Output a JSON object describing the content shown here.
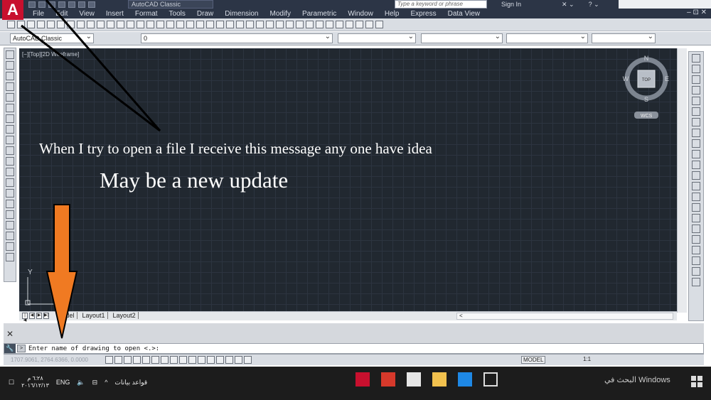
{
  "title_bar": {
    "workspace": "AutoCAD Classic",
    "search_placeholder": "Type a keyword or phrase",
    "sign_in": "Sign In"
  },
  "menu": {
    "items": [
      "File",
      "Edit",
      "View",
      "Insert",
      "Format",
      "Tools",
      "Draw",
      "Dimension",
      "Modify",
      "Parametric",
      "Window",
      "Help",
      "Express",
      "Data View"
    ],
    "window_controls": "– ⊡ ✕"
  },
  "toolbar": {
    "workspace_combo": "AutoCAD Classic",
    "layer_combo": "0"
  },
  "viewport": {
    "label": "[−][Top][2D Wireframe]",
    "viewcube_top": "TOP",
    "compass": {
      "n": "N",
      "s": "S",
      "e": "E",
      "w": "W"
    },
    "wcs": "WCS",
    "ucs_y": "Y"
  },
  "layout_tabs": [
    "Model",
    "Layout1",
    "Layout2"
  ],
  "command": {
    "prompt": "Enter name of drawing to open <.>:"
  },
  "status": {
    "coords": "1707.9061, 2764.6366, 0.0000",
    "model": "MODEL",
    "scale": "1:1"
  },
  "taskbar": {
    "clock_time": "٦:٢٨ م",
    "clock_date": "٢٠١٦/١٢/١٣",
    "lang": "ENG",
    "notif_text": "قواعد بيانات",
    "search": "البحث في Windows"
  },
  "annotations": {
    "message": "When I try to open a file I receive this message any one have idea",
    "update_note": "May be a new update"
  }
}
